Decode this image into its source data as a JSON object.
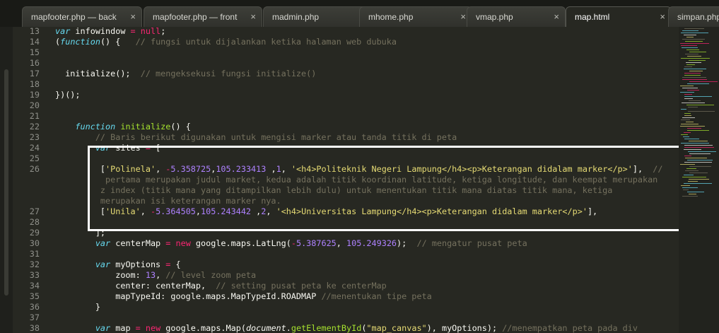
{
  "tabs": [
    {
      "label": "mapfooter.php — back",
      "active": false
    },
    {
      "label": "mapfooter.php — front",
      "active": false
    },
    {
      "label": "madmin.php",
      "active": false
    },
    {
      "label": "mhome.php",
      "active": false
    },
    {
      "label": "vmap.php",
      "active": false
    },
    {
      "label": "map.html",
      "active": true
    },
    {
      "label": "simpan.php",
      "active": false
    }
  ],
  "close_glyph": "×",
  "colors": {
    "background": "#272822",
    "keyword": "#66d9ef",
    "operator": "#f92672",
    "string": "#e6db74",
    "number": "#ae81ff",
    "comment": "#75715e",
    "function": "#a6e22e",
    "highlight_border": "#ffffff"
  },
  "lines": [
    {
      "num": "13",
      "parts": [
        [
          "k",
          "var"
        ],
        [
          "p",
          " infowindow "
        ],
        [
          "o",
          "="
        ],
        [
          "p",
          " "
        ],
        [
          "o",
          "null"
        ],
        [
          "p",
          ";"
        ]
      ]
    },
    {
      "num": "14",
      "parts": [
        [
          "p",
          "("
        ],
        [
          "k",
          "function"
        ],
        [
          "p",
          "() {   "
        ],
        [
          "c",
          "// fungsi untuk dijalankan ketika halaman web dubuka"
        ]
      ]
    },
    {
      "num": "15",
      "parts": []
    },
    {
      "num": "16",
      "parts": []
    },
    {
      "num": "17",
      "parts": [
        [
          "p",
          "  initialize();  "
        ],
        [
          "c",
          "// mengeksekusi fungsi initialize()"
        ]
      ]
    },
    {
      "num": "18",
      "parts": []
    },
    {
      "num": "19",
      "parts": [
        [
          "p",
          "})();"
        ]
      ]
    },
    {
      "num": "20",
      "parts": []
    },
    {
      "num": "21",
      "parts": []
    },
    {
      "num": "22",
      "parts": [
        [
          "p",
          "    "
        ],
        [
          "k",
          "function"
        ],
        [
          "p",
          " "
        ],
        [
          "f",
          "initialize"
        ],
        [
          "p",
          "() {"
        ]
      ]
    },
    {
      "num": "23",
      "parts": [
        [
          "p",
          "        "
        ],
        [
          "c",
          "// Baris berikut digunakan untuk mengisi marker atau tanda titik di peta"
        ]
      ]
    },
    {
      "num": "24",
      "parts": [
        [
          "p",
          "        "
        ],
        [
          "k",
          "var"
        ],
        [
          "p",
          " sites "
        ],
        [
          "o",
          "="
        ],
        [
          "p",
          " ["
        ]
      ]
    },
    {
      "num": "25",
      "parts": []
    },
    {
      "num": "26",
      "parts": [
        [
          "p",
          "         ["
        ],
        [
          "s",
          "'Polinela'"
        ],
        [
          "p",
          ", "
        ],
        [
          "o",
          "-"
        ],
        [
          "n",
          "5.358725"
        ],
        [
          "p",
          ","
        ],
        [
          "n",
          "105.233413"
        ],
        [
          "p",
          " ,"
        ],
        [
          "n",
          "1"
        ],
        [
          "p",
          ", "
        ],
        [
          "s",
          "'<h4>Politeknik Negeri Lampung</h4><p>Keterangan didalam marker</p>'"
        ],
        [
          "p",
          "],  "
        ],
        [
          "c",
          "//"
        ]
      ]
    },
    {
      "num": "",
      "parts": [
        [
          "c",
          "          pertama merupakan judul market, kedua adalah titik koordinan latitude, ketiga longitude, dan keempat merupakan"
        ]
      ]
    },
    {
      "num": "",
      "parts": [
        [
          "c",
          "         z index (titik mana yang ditampilkan lebih dulu) untuk menentukan titik mana diatas titik mana, ketiga"
        ]
      ]
    },
    {
      "num": "",
      "parts": [
        [
          "c",
          "         merupakan isi keterangan marker nya."
        ]
      ]
    },
    {
      "num": "27",
      "parts": [
        [
          "p",
          "         ["
        ],
        [
          "s",
          "'Unila'"
        ],
        [
          "p",
          ", "
        ],
        [
          "o",
          "-"
        ],
        [
          "n",
          "5.364505"
        ],
        [
          "p",
          ","
        ],
        [
          "n",
          "105.243442"
        ],
        [
          "p",
          " ,"
        ],
        [
          "n",
          "2"
        ],
        [
          "p",
          ", "
        ],
        [
          "s",
          "'<h4>Universitas Lampung</h4><p>Keterangan didalam marker</p>'"
        ],
        [
          "p",
          "],"
        ]
      ]
    },
    {
      "num": "28",
      "parts": []
    },
    {
      "num": "29",
      "parts": [
        [
          "p",
          "        ];"
        ]
      ]
    },
    {
      "num": "30",
      "parts": [
        [
          "p",
          "        "
        ],
        [
          "k",
          "var"
        ],
        [
          "p",
          " centerMap "
        ],
        [
          "o",
          "="
        ],
        [
          "p",
          " "
        ],
        [
          "o",
          "new"
        ],
        [
          "p",
          " google.maps.LatLng("
        ],
        [
          "o",
          "-"
        ],
        [
          "n",
          "5.387625"
        ],
        [
          "p",
          ", "
        ],
        [
          "n",
          "105.249326"
        ],
        [
          "p",
          ");  "
        ],
        [
          "c",
          "// mengatur pusat peta"
        ]
      ]
    },
    {
      "num": "31",
      "parts": []
    },
    {
      "num": "32",
      "parts": [
        [
          "p",
          "        "
        ],
        [
          "k",
          "var"
        ],
        [
          "p",
          " myOptions "
        ],
        [
          "o",
          "="
        ],
        [
          "p",
          " {"
        ]
      ]
    },
    {
      "num": "33",
      "parts": [
        [
          "p",
          "            zoom: "
        ],
        [
          "n",
          "13"
        ],
        [
          "p",
          ", "
        ],
        [
          "c",
          "// level zoom peta"
        ]
      ]
    },
    {
      "num": "34",
      "parts": [
        [
          "p",
          "            center: centerMap,  "
        ],
        [
          "c",
          "// setting pusat peta ke centerMap"
        ]
      ]
    },
    {
      "num": "35",
      "parts": [
        [
          "p",
          "            mapTypeId: google.maps.MapTypeId.ROADMAP "
        ],
        [
          "c",
          "//menentukan tipe peta"
        ]
      ]
    },
    {
      "num": "36",
      "parts": [
        [
          "p",
          "        }"
        ]
      ]
    },
    {
      "num": "37",
      "parts": []
    },
    {
      "num": "38",
      "parts": [
        [
          "p",
          "        "
        ],
        [
          "k",
          "var"
        ],
        [
          "p",
          " map "
        ],
        [
          "o",
          "="
        ],
        [
          "p",
          " "
        ],
        [
          "o",
          "new"
        ],
        [
          "p",
          " google.maps.Map("
        ],
        [
          "i",
          "document"
        ],
        [
          "p",
          "."
        ],
        [
          "f",
          "getElementById"
        ],
        [
          "p",
          "("
        ],
        [
          "s",
          "\"map_canvas\""
        ],
        [
          "p",
          "), myOptions); "
        ],
        [
          "c",
          "//menempatkan peta pada div"
        ]
      ]
    }
  ]
}
